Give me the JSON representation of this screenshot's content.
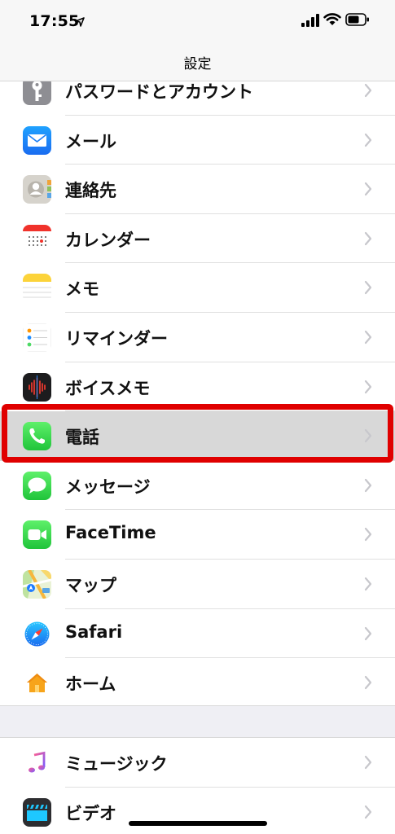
{
  "status": {
    "time": "17:55",
    "icons": [
      "location-arrow-icon",
      "signal-icon",
      "wifi-icon",
      "battery-icon"
    ]
  },
  "nav": {
    "title": "設定"
  },
  "settings_items": [
    {
      "label": "パスワードとアカウント",
      "icon": "key-icon"
    },
    {
      "label": "メール",
      "icon": "mail-icon"
    },
    {
      "label": "連絡先",
      "icon": "contacts-icon"
    },
    {
      "label": "カレンダー",
      "icon": "calendar-icon"
    },
    {
      "label": "メモ",
      "icon": "notes-icon"
    },
    {
      "label": "リマインダー",
      "icon": "reminders-icon"
    },
    {
      "label": "ボイスメモ",
      "icon": "voice-memo-icon"
    },
    {
      "label": "電話",
      "icon": "phone-icon",
      "highlighted": true
    },
    {
      "label": "メッセージ",
      "icon": "messages-icon"
    },
    {
      "label": "FaceTime",
      "icon": "facetime-icon"
    },
    {
      "label": "マップ",
      "icon": "maps-icon"
    },
    {
      "label": "Safari",
      "icon": "safari-icon"
    },
    {
      "label": "ホーム",
      "icon": "home-icon"
    }
  ],
  "media_items": [
    {
      "label": "ミュージック",
      "icon": "music-icon"
    },
    {
      "label": "ビデオ",
      "icon": "video-icon"
    }
  ],
  "colors": {
    "highlight_border": "#e00000",
    "highlight_bg": "#d8d8d8",
    "chevron": "#c7c7cc"
  }
}
